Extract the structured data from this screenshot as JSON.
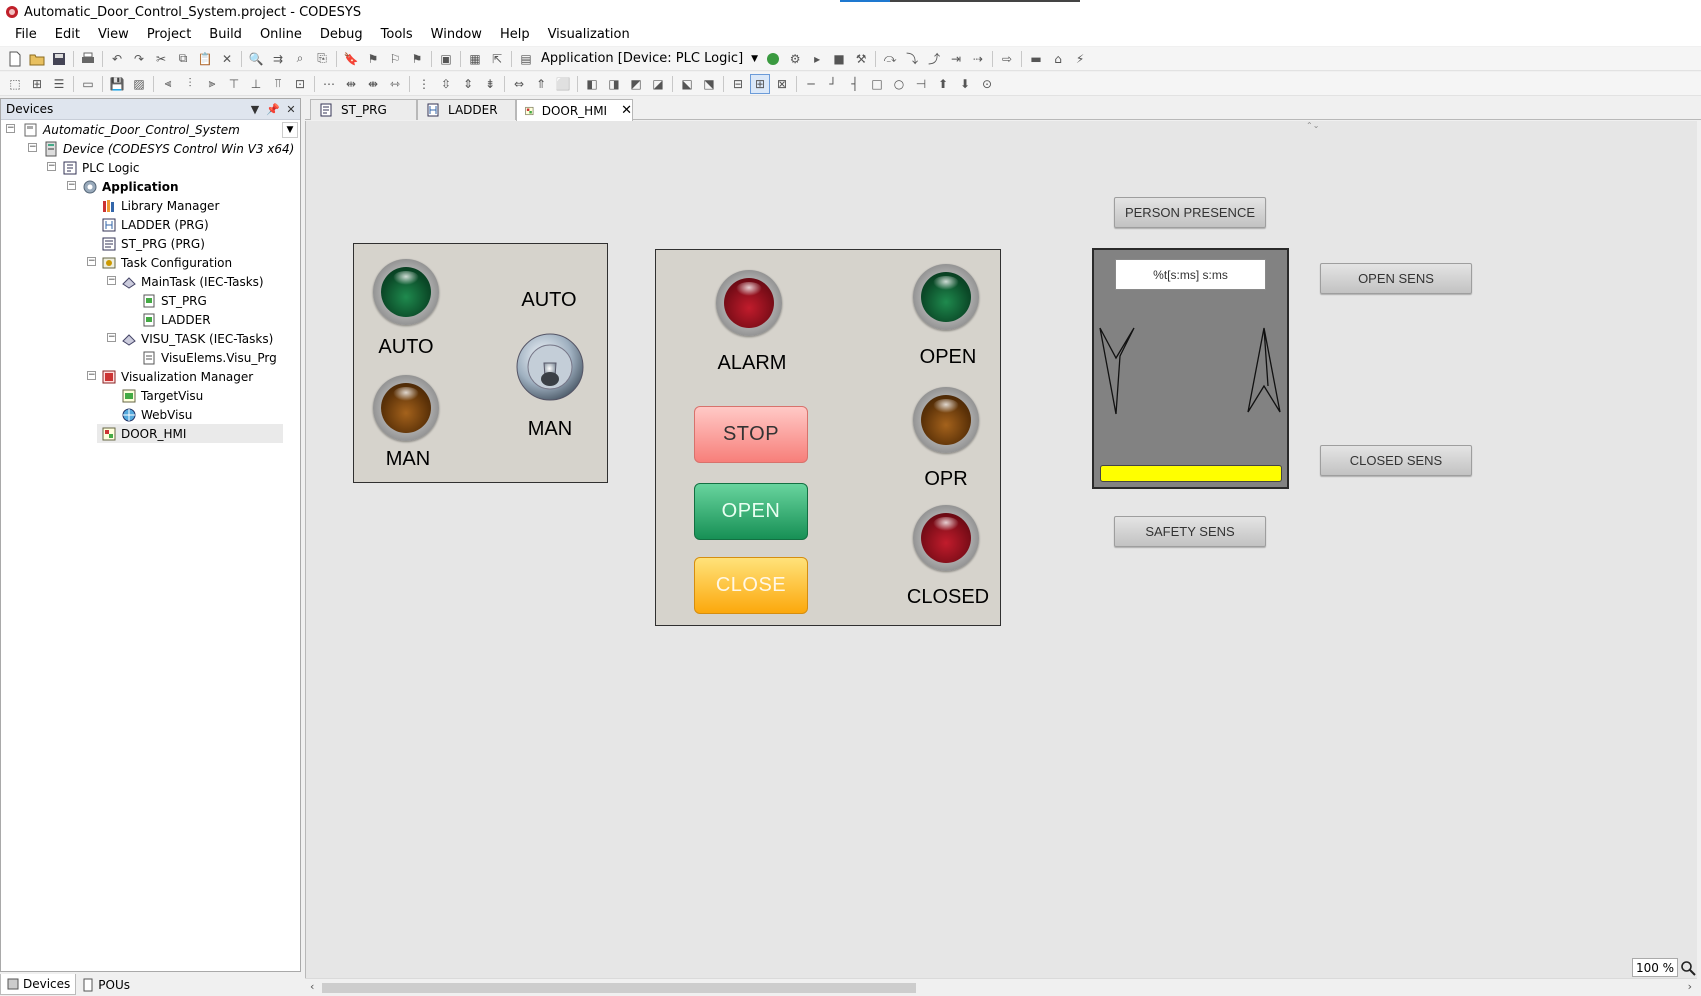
{
  "window": {
    "title": "Automatic_Door_Control_System.project - CODESYS"
  },
  "menu": [
    "File",
    "Edit",
    "View",
    "Project",
    "Build",
    "Online",
    "Debug",
    "Tools",
    "Window",
    "Help",
    "Visualization"
  ],
  "toolbar": {
    "app_selector": "Application [Device: PLC Logic]"
  },
  "devices_panel": {
    "title": "Devices",
    "tree": [
      {
        "label": "Automatic_Door_Control_System",
        "icon": "project-icon"
      },
      {
        "label": "Device (CODESYS Control Win V3 x64)",
        "icon": "device-icon"
      },
      {
        "label": "PLC Logic",
        "icon": "plc-logic-icon"
      },
      {
        "label": "Application",
        "icon": "application-gear-icon"
      },
      {
        "label": "Library Manager",
        "icon": "library-icon"
      },
      {
        "label": "LADDER (PRG)",
        "icon": "ladder-pou-icon"
      },
      {
        "label": "ST_PRG (PRG)",
        "icon": "st-pou-icon"
      },
      {
        "label": "Task Configuration",
        "icon": "task-config-icon"
      },
      {
        "label": "MainTask (IEC-Tasks)",
        "icon": "task-icon"
      },
      {
        "label": "ST_PRG",
        "icon": "program-call-icon"
      },
      {
        "label": "LADDER",
        "icon": "program-call-icon"
      },
      {
        "label": "VISU_TASK (IEC-Tasks)",
        "icon": "task-icon"
      },
      {
        "label": "VisuElems.Visu_Prg",
        "icon": "program-call-icon"
      },
      {
        "label": "Visualization Manager",
        "icon": "visu-manager-icon"
      },
      {
        "label": "TargetVisu",
        "icon": "target-visu-icon"
      },
      {
        "label": "WebVisu",
        "icon": "web-visu-icon"
      },
      {
        "label": "DOOR_HMI",
        "icon": "visualization-icon"
      }
    ]
  },
  "bottom_tabs": [
    "Devices",
    "POUs"
  ],
  "editor_tabs": [
    "ST_PRG",
    "LADDER",
    "DOOR_HMI"
  ],
  "hmi": {
    "mode_panel": {
      "lamp_auto_label": "AUTO",
      "lamp_man_label": "MAN",
      "switch_top_label": "AUTO",
      "switch_bottom_label": "MAN"
    },
    "control_panel": {
      "alarm_label": "ALARM",
      "open_lamp_label": "OPEN",
      "opr_lamp_label": "OPR",
      "closed_lamp_label": "CLOSED",
      "stop_button": "STOP",
      "open_button": "OPEN",
      "close_button": "CLOSE"
    },
    "door_panel": {
      "person_presence": "PERSON PRESENCE",
      "timer_text": "%t[s:ms] s:ms",
      "safety_sens": "SAFETY SENS",
      "open_sens": "OPEN SENS",
      "closed_sens": "CLOSED SENS"
    }
  },
  "statusbar": {
    "zoom": "100 %"
  }
}
